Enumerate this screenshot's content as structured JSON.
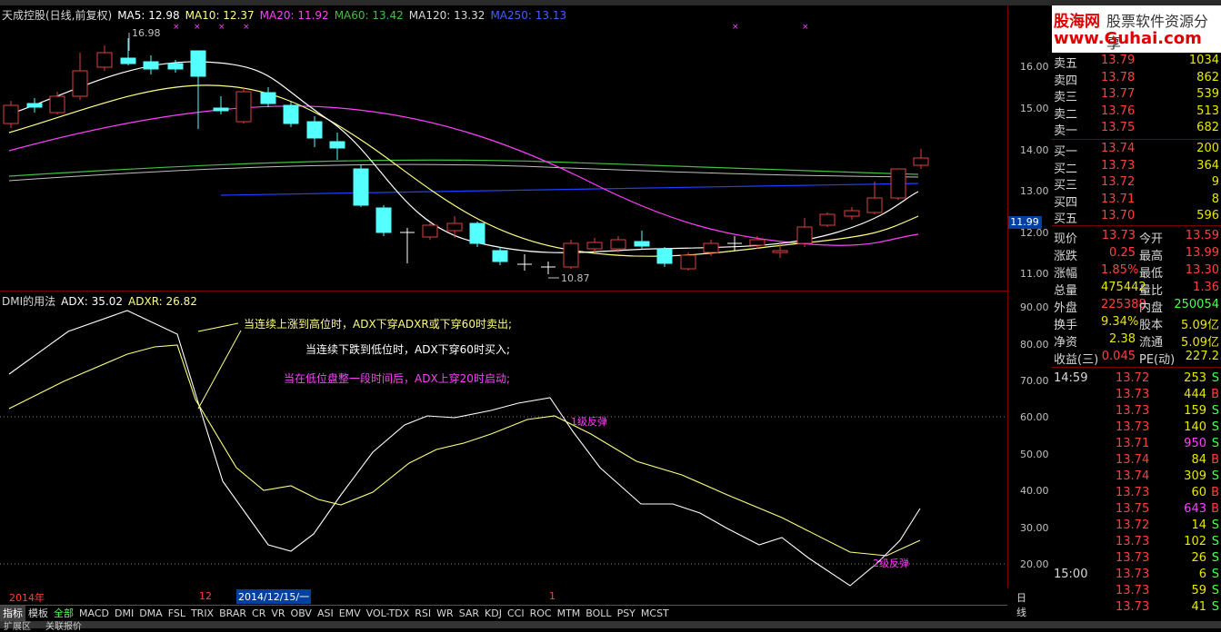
{
  "legend": {
    "title": "天成控股(日线,前复权)",
    "ma5": "MA5: 12.98",
    "ma10": "MA10: 12.37",
    "ma20": "MA20: 11.92",
    "ma60": "MA60: 13.42",
    "ma120": "MA120: 13.32",
    "ma250": "MA250: 13.13"
  },
  "main_axis": [
    "16.00",
    "15.00",
    "14.00",
    "13.00",
    "12.00",
    "11.00"
  ],
  "price_badge": "11.99",
  "high_label": "16.98",
  "low_label": "10.87",
  "dmi_legend": {
    "title": "DMI的用法",
    "adx": "ADX: 35.02",
    "adxr": "ADXR: 26.82"
  },
  "dmi_axis": [
    "90.00",
    "80.00",
    "70.00",
    "60.00",
    "50.00",
    "40.00",
    "30.00",
    "20.00"
  ],
  "annotations": {
    "a1": "当连续上涨到高位时，ADX下穿ADXR或下穿60时卖出;",
    "a2": "当连续下跌到低位时，ADX下穿60时买入;",
    "a3": "当在低位盘整一段时间后，ADX上穿20时启动;",
    "a4": "1级反弹",
    "a5": "2级反弹"
  },
  "date_axis": {
    "year": "2014年",
    "m12": "12",
    "cursor_date": "2014/12/15/一",
    "m1": "1",
    "period": "日线"
  },
  "tabs": [
    "指标",
    "模板",
    "全部",
    "MACD",
    "DMI",
    "DMA",
    "FSL",
    "TRIX",
    "BRAR",
    "CR",
    "VR",
    "OBV",
    "ASI",
    "EMV",
    "VOL-TDX",
    "RSI",
    "WR",
    "SAR",
    "KDJ",
    "CCI",
    "ROC",
    "MTM",
    "BOLL",
    "PSY",
    "MCST"
  ],
  "bottom_bar": [
    "扩展区",
    "关联报价"
  ],
  "logo": {
    "brand": "股海网",
    "slogan": "股票软件资源分享",
    "url": "www.Guhai.com"
  },
  "asks": [
    {
      "label": "卖五",
      "price": "13.79",
      "vol": "1034"
    },
    {
      "label": "卖四",
      "price": "13.78",
      "vol": "862"
    },
    {
      "label": "卖三",
      "price": "13.77",
      "vol": "539"
    },
    {
      "label": "卖二",
      "price": "13.76",
      "vol": "513"
    },
    {
      "label": "卖一",
      "price": "13.75",
      "vol": "682"
    }
  ],
  "bids": [
    {
      "label": "买一",
      "price": "13.74",
      "vol": "200"
    },
    {
      "label": "买二",
      "price": "13.73",
      "vol": "364"
    },
    {
      "label": "买三",
      "price": "13.72",
      "vol": "9"
    },
    {
      "label": "买四",
      "price": "13.71",
      "vol": "8"
    },
    {
      "label": "买五",
      "price": "13.70",
      "vol": "596"
    }
  ],
  "stats": [
    {
      "l1": "现价",
      "v1": "13.73",
      "l2": "今开",
      "v2": "13.59"
    },
    {
      "l1": "涨跌",
      "v1": "0.25",
      "l2": "最高",
      "v2": "13.99"
    },
    {
      "l1": "涨幅",
      "v1": "1.85%",
      "l2": "最低",
      "v2": "13.30"
    },
    {
      "l1": "总量",
      "v1": "475442",
      "l2": "量比",
      "v2": "1.36"
    },
    {
      "l1": "外盘",
      "v1": "225388",
      "l2": "内盘",
      "v2": "250054"
    },
    {
      "l1": "换手",
      "v1": "9.34%",
      "l2": "股本",
      "v2": "5.09亿"
    },
    {
      "l1": "净资",
      "v1": "2.38",
      "l2": "流通",
      "v2": "5.09亿"
    },
    {
      "l1": "收益(三)",
      "v1": "0.045",
      "l2": "PE(动)",
      "v2": "227.2"
    }
  ],
  "ticks": [
    {
      "t": "14:59",
      "p": "13.72",
      "v": "253",
      "bs": "S"
    },
    {
      "t": "",
      "p": "13.73",
      "v": "444",
      "bs": "B"
    },
    {
      "t": "",
      "p": "13.73",
      "v": "159",
      "bs": "S"
    },
    {
      "t": "",
      "p": "13.73",
      "v": "140",
      "bs": "S"
    },
    {
      "t": "",
      "p": "13.71",
      "v": "950",
      "bs": "S"
    },
    {
      "t": "",
      "p": "13.74",
      "v": "84",
      "bs": "B"
    },
    {
      "t": "",
      "p": "13.74",
      "v": "309",
      "bs": "S"
    },
    {
      "t": "",
      "p": "13.73",
      "v": "60",
      "bs": "B"
    },
    {
      "t": "",
      "p": "13.75",
      "v": "643",
      "bs": "B"
    },
    {
      "t": "",
      "p": "13.72",
      "v": "14",
      "bs": "S"
    },
    {
      "t": "",
      "p": "13.73",
      "v": "102",
      "bs": "S"
    },
    {
      "t": "",
      "p": "13.73",
      "v": "26",
      "bs": "S"
    },
    {
      "t": "15:00",
      "p": "13.73",
      "v": "6",
      "bs": "S"
    },
    {
      "t": "",
      "p": "13.73",
      "v": "59",
      "bs": "S"
    },
    {
      "t": "",
      "p": "13.73",
      "v": "41",
      "bs": "S"
    }
  ],
  "colors": {
    "up": "#e04040",
    "down": "#54ffff",
    "ma5": "#ffffff",
    "ma10": "#ffff80",
    "ma20": "#ff40ff",
    "ma60": "#40c040",
    "ma120": "#c0c0c0",
    "ma250": "#2040ff"
  }
}
